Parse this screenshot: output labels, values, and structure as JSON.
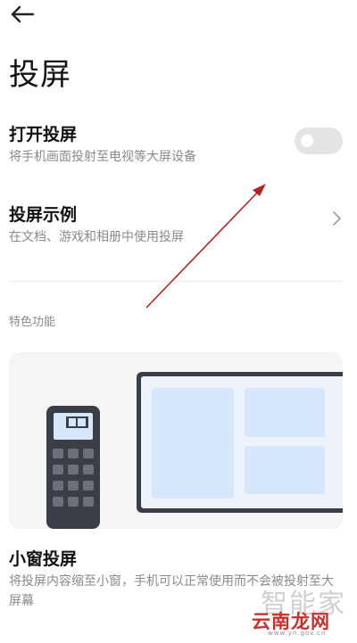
{
  "page": {
    "title": "投屏"
  },
  "settings": {
    "cast": {
      "title": "打开投屏",
      "subtitle": "将手机画面投射至电视等大屏设备",
      "enabled": false
    },
    "examples": {
      "title": "投屏示例",
      "subtitle": "在文档、游戏和相册中使用投屏"
    }
  },
  "features": {
    "header": "特色功能",
    "mini_window": {
      "title": "小窗投屏",
      "description": "将投屏内容缩至小窗，手机可以正常使用而不会被投射至大屏幕"
    }
  },
  "watermark": {
    "top": "智能家",
    "bottom": "云南龙网",
    "url": "www.yn.gov.cn"
  },
  "colors": {
    "illustration_blue": "#d6e6fb",
    "illustration_frame": "#3a3f47",
    "toggle_off": "#e4e4e4",
    "annotation_arrow": "#b32424"
  }
}
